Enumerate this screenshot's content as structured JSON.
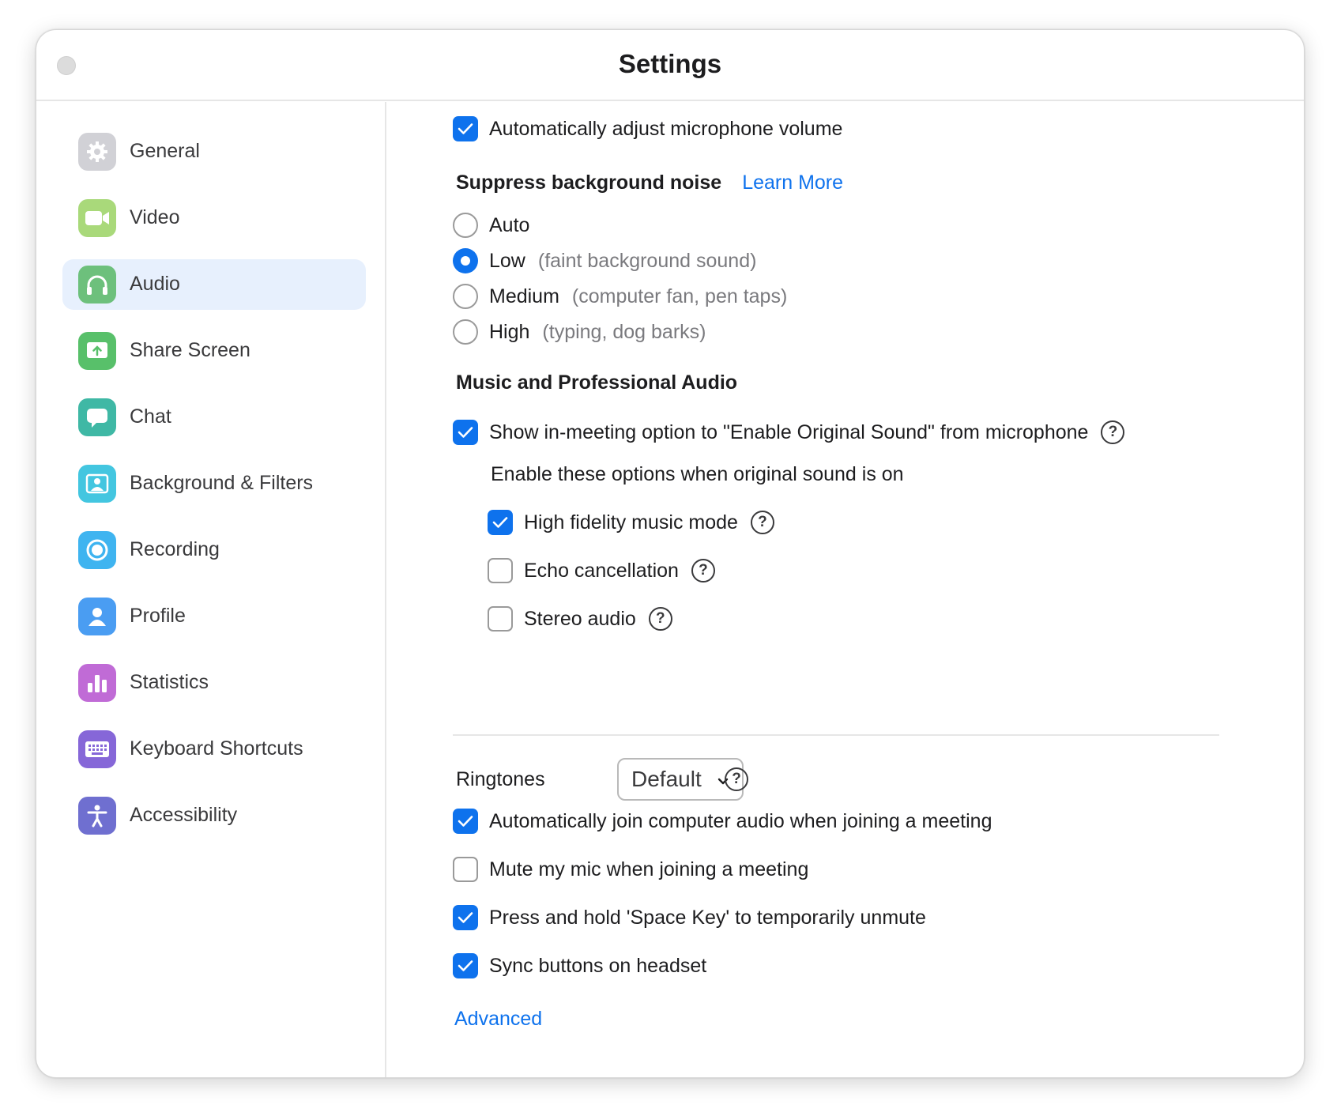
{
  "window": {
    "title": "Settings"
  },
  "sidebar": {
    "items": [
      {
        "label": "General",
        "icon": "gear-icon",
        "color": "#d1d1d6",
        "active": false
      },
      {
        "label": "Video",
        "icon": "video-camera-icon",
        "color": "#a9d97a",
        "active": false
      },
      {
        "label": "Audio",
        "icon": "headphones-icon",
        "color": "#6dc07c",
        "active": true
      },
      {
        "label": "Share Screen",
        "icon": "share-screen-icon",
        "color": "#58c06a",
        "active": false
      },
      {
        "label": "Chat",
        "icon": "chat-bubble-icon",
        "color": "#3fb8a5",
        "active": false
      },
      {
        "label": "Background & Filters",
        "icon": "background-person-icon",
        "color": "#43c6e0",
        "active": false
      },
      {
        "label": "Recording",
        "icon": "record-icon",
        "color": "#3fb4f0",
        "active": false
      },
      {
        "label": "Profile",
        "icon": "profile-person-icon",
        "color": "#4a9df2",
        "active": false
      },
      {
        "label": "Statistics",
        "icon": "bar-chart-icon",
        "color": "#c06bd6",
        "active": false
      },
      {
        "label": "Keyboard Shortcuts",
        "icon": "keyboard-icon",
        "color": "#8667d8",
        "active": false
      },
      {
        "label": "Accessibility",
        "icon": "accessibility-icon",
        "color": "#6f6fd0",
        "active": false
      }
    ]
  },
  "audio": {
    "auto_adjust_mic": {
      "label": "Automatically adjust microphone volume",
      "checked": true
    },
    "suppress": {
      "heading": "Suppress background noise",
      "learn_more": "Learn More",
      "options": [
        {
          "label": "Auto",
          "hint": "",
          "selected": false
        },
        {
          "label": "Low",
          "hint": "(faint background sound)",
          "selected": true
        },
        {
          "label": "Medium",
          "hint": "(computer fan, pen taps)",
          "selected": false
        },
        {
          "label": "High",
          "hint": "(typing, dog barks)",
          "selected": false
        }
      ]
    },
    "music": {
      "heading": "Music and Professional Audio",
      "original_sound": {
        "label": "Show in-meeting option to \"Enable Original Sound\" from microphone",
        "checked": true
      },
      "subheading": "Enable these options when original sound is on",
      "options": [
        {
          "label": "High fidelity music mode",
          "checked": true
        },
        {
          "label": "Echo cancellation",
          "checked": false
        },
        {
          "label": "Stereo audio",
          "checked": false
        }
      ]
    },
    "ringtones": {
      "label": "Ringtones",
      "value": "Default"
    },
    "options": [
      {
        "label": "Automatically join computer audio when joining a meeting",
        "checked": true
      },
      {
        "label": "Mute my mic when joining a meeting",
        "checked": false
      },
      {
        "label": "Press and hold 'Space Key' to temporarily unmute",
        "checked": true
      },
      {
        "label": "Sync buttons on headset",
        "checked": true
      }
    ],
    "advanced": "Advanced"
  },
  "colors": {
    "accent": "#0e72ed",
    "active_bg": "#e7f0fd"
  }
}
